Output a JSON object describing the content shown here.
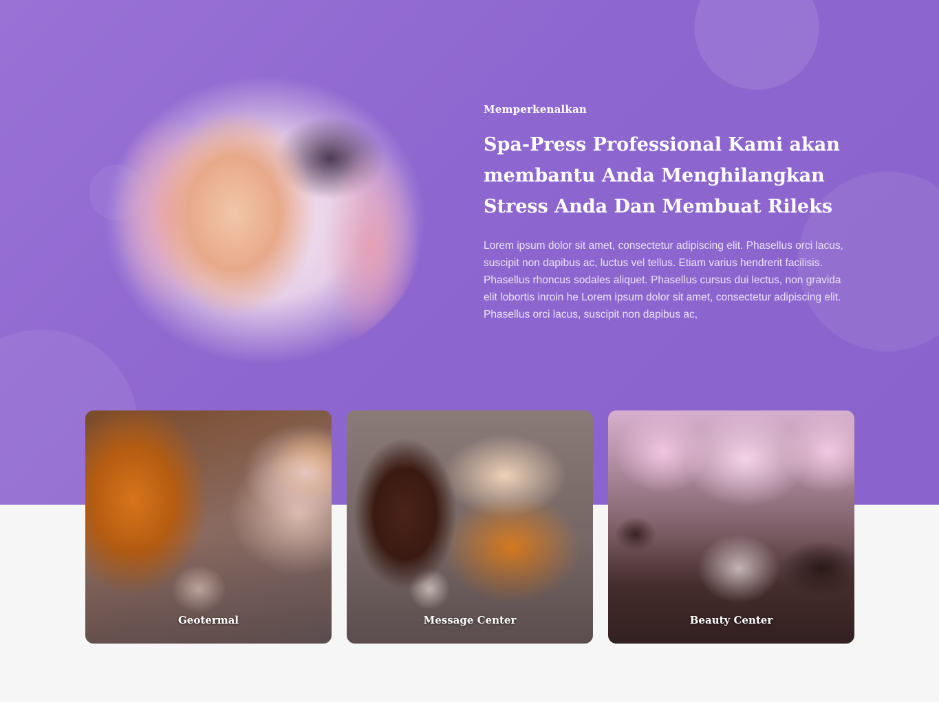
{
  "hero": {
    "eyebrow": "Memperkenalkan",
    "headline": "Spa-Press Professional Kami akan membantu Anda Menghilangkan Stress Anda Dan Membuat Rileks",
    "body": "Lorem ipsum dolor sit amet, consectetur adipiscing elit. Phasellus orci lacus, suscipit non dapibus ac, luctus vel tellus. Etiam varius hendrerit facilisis. Phasellus rhoncus sodales aliquet. Phasellus cursus dui lectus, non gravida elit lobortis inroin he Lorem ipsum dolor sit amet, consectetur adipiscing elit. Phasellus orci lacus, suscipit non dapibus ac,"
  },
  "cards": [
    {
      "label": "Geotermal"
    },
    {
      "label": "Message Center"
    },
    {
      "label": "Beauty Center"
    }
  ],
  "colors": {
    "hero_background": "#8d66cf",
    "page_background": "#f6f6f6",
    "text": "#ffffff"
  }
}
